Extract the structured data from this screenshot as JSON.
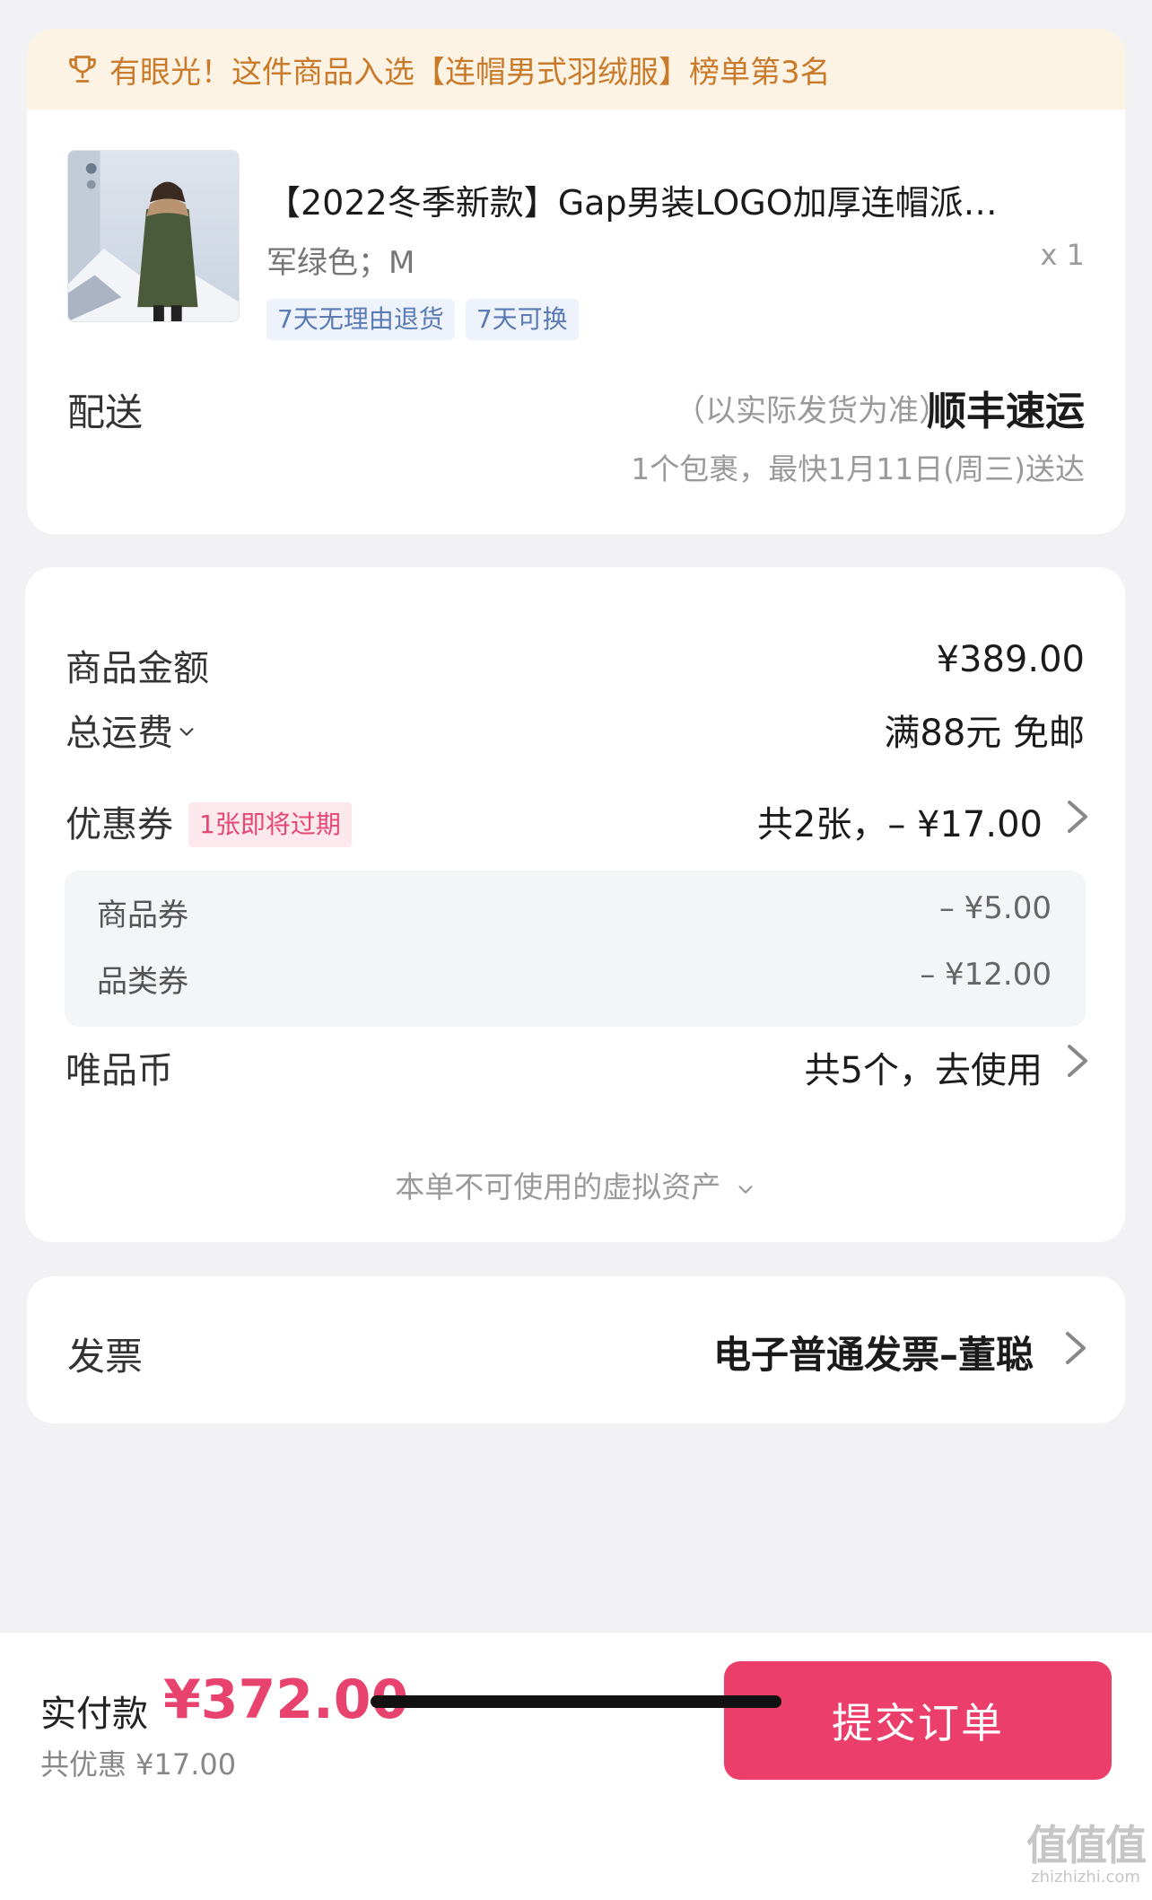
{
  "banner": {
    "text": "有眼光！这件商品入选【连帽男式羽绒服】榜单第3名"
  },
  "product": {
    "title": "【2022冬季新款】Gap男装LOGO加厚连帽派…",
    "spec": "军绿色；M",
    "quantity": "x 1",
    "tags": [
      "7天无理由退货",
      "7天可换"
    ]
  },
  "delivery": {
    "label": "配送",
    "note": "（以实际发货为准）",
    "carrier": "顺丰速运",
    "eta": "1个包裹，最快1月11日(周三)送达"
  },
  "price": {
    "goods_label": "商品金额",
    "goods_value": "¥389.00",
    "shipping_label": "总运费",
    "shipping_value": "满88元 免邮",
    "coupon_label": "优惠券",
    "coupon_badge": "1张即将过期",
    "coupon_value": "共2张，– ¥17.00",
    "coupon_items": [
      {
        "label": "商品券",
        "value": "– ¥5.00"
      },
      {
        "label": "品类券",
        "value": "– ¥12.00"
      }
    ],
    "coins_label": "唯品币",
    "coins_value": "共5个，去使用",
    "virtual_assets": "本单不可使用的虚拟资产"
  },
  "invoice": {
    "label": "发票",
    "value": "电子普通发票–董聪"
  },
  "footer": {
    "pay_label": "实付款",
    "pay_amount": "¥372.00",
    "discount": "共优惠 ¥17.00",
    "submit_label": "提交订单"
  },
  "watermark": {
    "logo": "值值值",
    "url": "zhizhizhi.com"
  },
  "colors": {
    "accent": "#e8436e",
    "banner_text": "#c97a2a",
    "banner_bg": "#fdf3e4",
    "tag_text": "#5a7bb5"
  }
}
